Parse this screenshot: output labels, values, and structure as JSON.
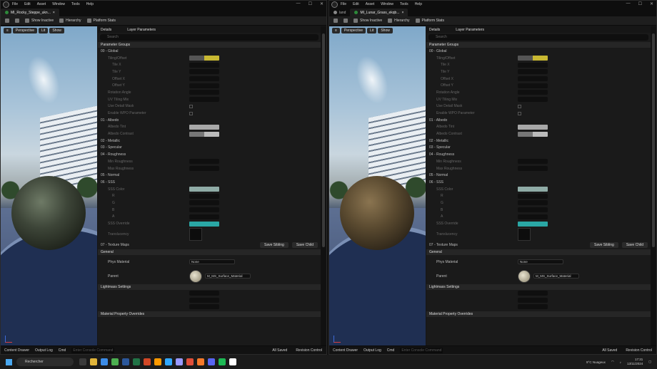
{
  "left": {
    "tab": "MI_Rocky_Steppe_ukn...",
    "tab_close": "×"
  },
  "right": {
    "tab1": "land",
    "tab2": "MI_Lunar_Grass_ekqb...",
    "tab_close": "×"
  },
  "menu": [
    "File",
    "Edit",
    "Asset",
    "Window",
    "Tools",
    "Help"
  ],
  "toolbar": {
    "show_inactive": "Show Inactive",
    "hierarchy": "Hierarchy",
    "platform_stats": "Platform Stats"
  },
  "viewport": {
    "perspective": "Perspective",
    "lit": "Lit",
    "show": "Show"
  },
  "panel": {
    "details": "Details",
    "layer_params": "Layer Parameters",
    "search": "Search"
  },
  "sections": {
    "param_groups": "Parameter Groups",
    "global": "00 - Global",
    "albedo": "01 - Albedo",
    "metallic": "02 - Metallic",
    "specular": "03 - Specular",
    "roughness": "04 - Roughness",
    "normal": "05 - Normal",
    "sss": "06 - SSS",
    "texture_maps": "07 - Texture Maps",
    "general": "General",
    "lightmass": "Lightmass Settings",
    "mat_override": "Material Property Overrides"
  },
  "rows": {
    "tiling": "Tiling/Offset",
    "tile_x": "Tile X",
    "tile_y": "Tile Y",
    "off_x": "Offset X",
    "off_y": "Offset Y",
    "rotation": "Rotation Angle",
    "uv_tiling": "UV Tiling Mix",
    "use_ao": "Use Detail Mask",
    "use_wp": "Enable WPO Parameter",
    "albedo_tint": "Albedo Tint",
    "albedo_contrast": "Albedo Contrast",
    "min_rough": "Min Roughness",
    "max_rough": "Max Roughness",
    "sss_color": "SSS Color",
    "r": "R",
    "g": "G",
    "b": "B",
    "a": "A",
    "sss_override": "SSS Override",
    "translucency": "Translucency"
  },
  "vals": {
    "v1": "1.0",
    "v2": "0.0",
    "v3": "0.5"
  },
  "buttons": {
    "save_sibling": "Save Sibling",
    "save_child": "Save Child"
  },
  "general": {
    "phys": "Phys Material",
    "none": "None",
    "parent": "Parent",
    "parent_val": "M_MS_Surface_Material"
  },
  "status": {
    "content_drawer": "Content Drawer",
    "output_log": "Output Log",
    "cmd": "Cmd",
    "cmd_placeholder": "Enter Console Command",
    "all_saved": "All Saved",
    "revision": "Revision Control"
  },
  "taskbar": {
    "search": "Rechercher",
    "weather": "9°C Nuageux",
    "time": "17:31",
    "date": "13/11/2024"
  },
  "colors": {
    "accent": "#c8b832",
    "teal": "#2aa7a5",
    "sss": "#8faba6"
  }
}
